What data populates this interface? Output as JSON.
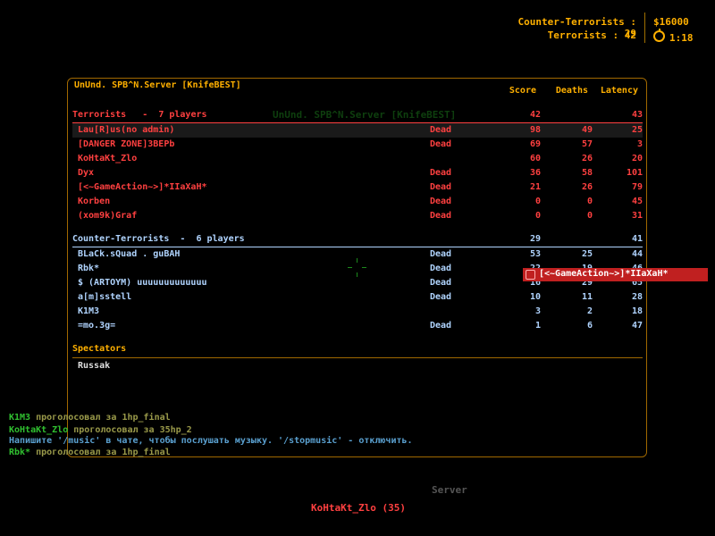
{
  "hud": {
    "ct_score_label": "Counter-Terrorists : 29",
    "t_score_label": "Terrorists : 42",
    "money": "$16000",
    "timer_icon": "stopwatch-icon",
    "timer": "1:18"
  },
  "board": {
    "server_name": "UnUnd. SPB^N.Server [KnifeBEST]",
    "ghost_title": "UnUnd. SPB^N.Server [KnifeBEST]",
    "columns": {
      "score": "Score",
      "deaths": "Deaths",
      "latency": "Latency"
    },
    "terrorists": {
      "header": "Terrorists   -  7 players",
      "score": "42",
      "latency": "43",
      "color": "#ff4040",
      "players": [
        {
          "name": "Lau[R]us(no admin)",
          "status": "Dead",
          "score": "98",
          "deaths": "49",
          "latency": "25"
        },
        {
          "name": "[DANGER ZONE]3BEPb",
          "status": "Dead",
          "score": "69",
          "deaths": "57",
          "latency": "3"
        },
        {
          "name": "KoHtaKt_Zlo",
          "status": "",
          "score": "60",
          "deaths": "26",
          "latency": "20"
        },
        {
          "name": "Dyx",
          "status": "Dead",
          "score": "36",
          "deaths": "58",
          "latency": "101"
        },
        {
          "name": "[<~GameAction~>]*IIaXaH*",
          "status": "Dead",
          "score": "21",
          "deaths": "26",
          "latency": "79"
        },
        {
          "name": "Korben",
          "status": "Dead",
          "score": "0",
          "deaths": "0",
          "latency": "45"
        },
        {
          "name": "(xom9k)Graf",
          "status": "Dead",
          "score": "0",
          "deaths": "0",
          "latency": "31"
        }
      ]
    },
    "counter_terrorists": {
      "header": "Counter-Terrorists  -  6 players",
      "score": "29",
      "latency": "41",
      "color": "#b0d4ff",
      "players": [
        {
          "name": "BLaCk.sQuad . guBAH",
          "status": "Dead",
          "score": "53",
          "deaths": "25",
          "latency": "44"
        },
        {
          "name": "Rbk*",
          "status": "Dead",
          "score": "22",
          "deaths": "19",
          "latency": "46"
        },
        {
          "name": "$ (ARTOYM) uuuuuuuuuuuuu",
          "status": "Dead",
          "score": "16",
          "deaths": "29",
          "latency": "65"
        },
        {
          "name": "a[m]sstell",
          "status": "Dead",
          "score": "10",
          "deaths": "11",
          "latency": "28"
        },
        {
          "name": "K1M3",
          "status": "",
          "score": "3",
          "deaths": "2",
          "latency": "18"
        },
        {
          "name": "=mo.3g=",
          "status": "Dead",
          "score": "1",
          "deaths": "6",
          "latency": "47"
        }
      ]
    },
    "spectators": {
      "header": "Spectators",
      "players": [
        "Russak"
      ]
    }
  },
  "popup": {
    "icon": "speaker-icon",
    "text": "[<~GameAction~>]*IIaXaH*"
  },
  "chat": {
    "line1": {
      "who": "K1M3",
      "msg": " проголосовал за 1hp_final"
    },
    "line2": {
      "who": "KoHtaKt_Zlo",
      "msg": " проголосовал за 35hp_2"
    },
    "line3": {
      "info": "Напишите '/music' в чате, чтобы послушать музыку. '/stopmusic' - отключить."
    },
    "line4": {
      "who": "Rbk*",
      "msg": " проголосовал за 1hp_final"
    }
  },
  "spectate": {
    "mode_label": "Server",
    "target": "KoHtaKt_Zlo (35)"
  }
}
